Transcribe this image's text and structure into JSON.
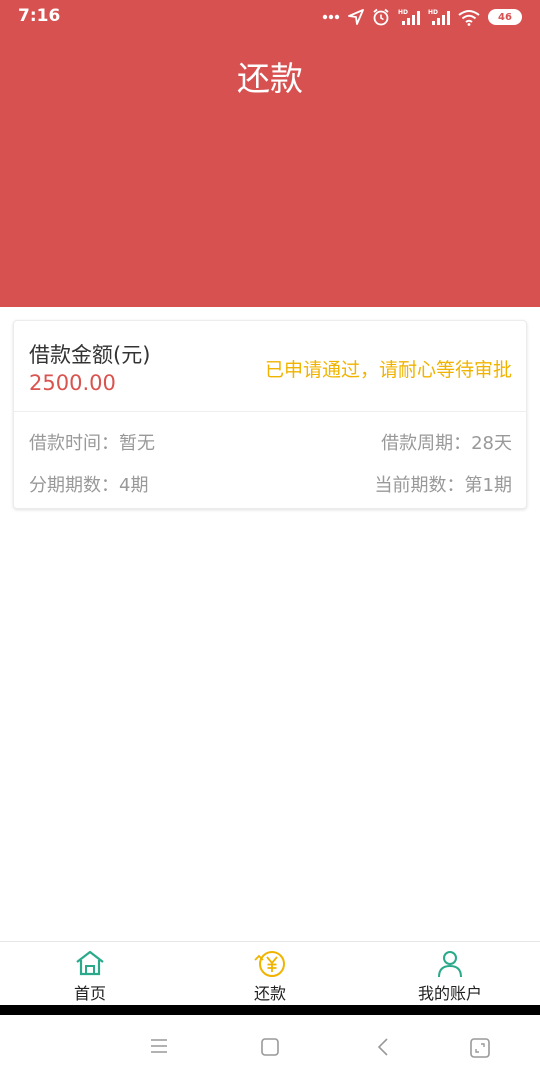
{
  "status_bar": {
    "time": "7:16",
    "battery": "46"
  },
  "header": {
    "title": "还款"
  },
  "loan_card": {
    "amount_label": "借款金额(元)",
    "amount_value": "2500.00",
    "status": "已申请通过，请耐心等待审批",
    "loan_time": "借款时间：暂无",
    "loan_period": "借款周期：28天",
    "installments": "分期期数：4期",
    "current_installment": "当前期数：第1期"
  },
  "tabs": [
    {
      "label": "首页"
    },
    {
      "label": "还款"
    },
    {
      "label": "我的账户"
    }
  ],
  "colors": {
    "header": "#d85151",
    "status": "#f0b400",
    "amount": "#d9534f",
    "tab_icon": "#2aa98b",
    "active_icon": "#f0b400"
  },
  "icons": [
    "home-icon",
    "repay-yen-icon",
    "user-icon",
    "menu-icon",
    "home-square-icon",
    "back-icon",
    "recent-apps-icon"
  ]
}
